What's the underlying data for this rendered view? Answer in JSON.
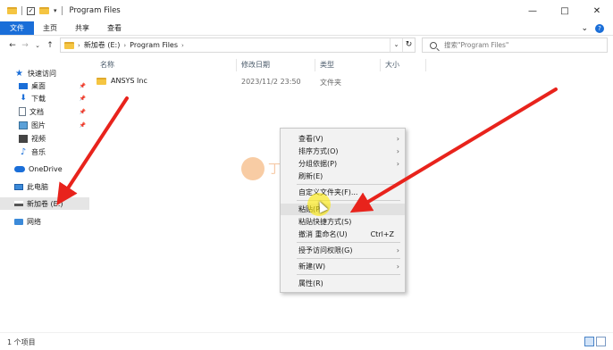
{
  "titlebar": {
    "title": "Program Files",
    "minimize": "—",
    "maximize": "□",
    "close": "✕",
    "check_mark": "✓",
    "qa_dropdown": "▾"
  },
  "ribbon": {
    "tabs": [
      "文件",
      "主页",
      "共享",
      "查看"
    ],
    "collapse": "⌄",
    "help": "?"
  },
  "nav": {
    "back": "←",
    "forward": "→",
    "recent": "⌄",
    "up": "↑",
    "refresh": "↻",
    "dropdown": "⌄",
    "crumb_sep": "›",
    "breadcrumbs": [
      "新加卷 (E:)",
      "Program Files"
    ],
    "search_placeholder": "搜索\"Program Files\""
  },
  "sidebar": {
    "quick_access": "快速访问",
    "desktop": "桌面",
    "downloads": "下载",
    "documents": "文档",
    "pictures": "图片",
    "videos": "视频",
    "music": "音乐",
    "onedrive": "OneDrive",
    "this_pc": "此电脑",
    "drive_e": "新加卷 (E:)",
    "network": "网络",
    "pin": "📌",
    "star": "★",
    "down_arrow": "⬇",
    "note": "♪"
  },
  "columns": {
    "name": "名称",
    "date": "修改日期",
    "type": "类型",
    "size": "大小"
  },
  "files": [
    {
      "name": "ANSYS Inc",
      "date": "2023/11/2 23:50",
      "type": "文件夹"
    }
  ],
  "status": {
    "count": "1 个项目"
  },
  "context_menu": {
    "arrow": "›",
    "items": {
      "view": "查看(V)",
      "sort": "排序方式(O)",
      "group": "分组依据(P)",
      "refresh": "刷新(E)",
      "customize": "自定义文件夹(F)...",
      "paste": "粘贴(P)",
      "paste_shortcut": "粘贴快捷方式(S)",
      "undo_rename": "撤消 重命名(U)",
      "undo_accel": "Ctrl+Z",
      "grant_access": "授予访问权限(G)",
      "new": "新建(W)",
      "properties": "属性(R)"
    }
  },
  "watermark": {
    "text": "丁丁自记本"
  },
  "colors": {
    "accent": "#1a6ed8",
    "folder": "#f5c542",
    "annotation_arrow": "#e8231c"
  }
}
